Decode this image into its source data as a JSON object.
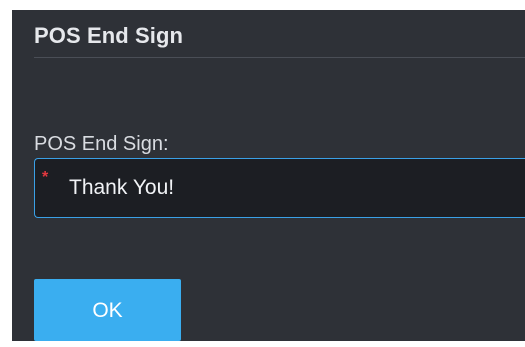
{
  "dialog": {
    "title": "POS End Sign",
    "field_label": "POS End Sign:",
    "input_value": "Thank You!",
    "required_mark": "*",
    "ok_label": "OK"
  },
  "colors": {
    "panel_background": "#2e3137",
    "input_background": "#1c1e23",
    "input_border": "#3aa0e6",
    "button_background": "#3aaef0",
    "required_mark": "#e2383f"
  }
}
